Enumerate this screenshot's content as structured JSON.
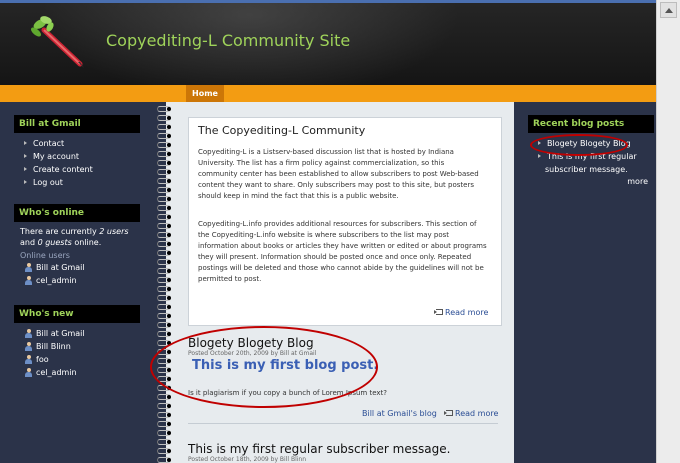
{
  "site": {
    "name": "Copyediting-L Community Site",
    "logo_icon": "celery-pencil-logo"
  },
  "nav": {
    "home_label": "Home"
  },
  "left_sidebar": {
    "user_block": {
      "title": "Bill at Gmail",
      "items": [
        "Contact",
        "My account",
        "Create content",
        "Log out"
      ]
    },
    "whos_online": {
      "title": "Who's online",
      "text_pre": "There are currently ",
      "users_count": "2 users",
      "text_mid": " and ",
      "guests_count": "0 guests",
      "text_post": " online.",
      "online_users_label": "Online users",
      "users": [
        "Bill at Gmail",
        "cel_admin"
      ]
    },
    "whos_new": {
      "title": "Who's new",
      "users": [
        "Bill at Gmail",
        "Bill Blinn",
        "foo",
        "cel_admin"
      ]
    }
  },
  "right_sidebar": {
    "recent_posts": {
      "title": "Recent blog posts",
      "items": [
        "Blogety Blogety Blog",
        "This is my first regular",
        "subscriber message."
      ],
      "more_label": "more"
    }
  },
  "main": {
    "intro": {
      "title": "The Copyediting-L Community",
      "para1": [
        "Copyediting-L is a Listserv-based discussion list that is hosted by Indiana",
        "University. The list has a firm policy against commercialization, so this",
        "community center has been established to allow subscribers to post Web-based",
        "content they want to share. Only subscribers may post to this site, but posters",
        "should keep in mind the fact that this is a public website."
      ],
      "para2": [
        "Copyediting-L.info provides additional resources for subscribers. This section of",
        "the Copyediting-L.info website is where subscribers to the list may post",
        "information about books or articles they have written or edited or about programs",
        "they will present. Information should be posted once and once only. Repeated",
        "postings will be deleted and those who cannot abide by the guidelines will not be",
        "permitted to post."
      ],
      "read_more": "Read more"
    },
    "post1": {
      "title": "Blogety Blogety Blog",
      "posted": "Posted October 20th, 2009 by Bill at Gmail",
      "heading": "This is my first blog post.",
      "body": "Is it plagiarism if you copy a bunch of Lorem Ipsum text?",
      "author_link": "Bill at Gmail's blog",
      "read_more": "Read more"
    },
    "post2": {
      "title": "This is my first regular subscriber message.",
      "posted": "Posted October 18th, 2009 by Bill Blinn"
    }
  },
  "colors": {
    "accent_green": "#9fd35a",
    "nav_orange": "#f39c12",
    "sidebar_bg": "#2b3349",
    "annotation_red": "#c00000",
    "link_blue": "#2b4e95"
  }
}
